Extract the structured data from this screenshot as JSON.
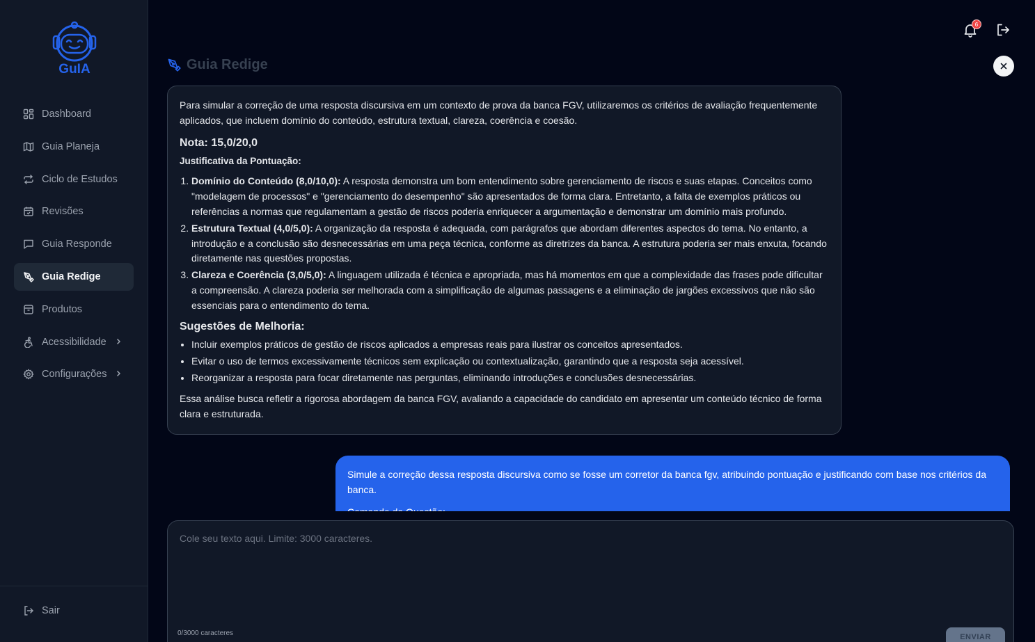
{
  "app": {
    "logo_text": "GuIA"
  },
  "sidebar": {
    "items": [
      {
        "label": "Dashboard",
        "icon": "dashboard-icon"
      },
      {
        "label": "Guia Planeja",
        "icon": "map-icon"
      },
      {
        "label": "Ciclo de Estudos",
        "icon": "repeat-icon"
      },
      {
        "label": "Revisões",
        "icon": "calendar-icon"
      },
      {
        "label": "Guia Responde",
        "icon": "message-icon"
      },
      {
        "label": "Guia Redige",
        "icon": "pen-tool-icon",
        "active": true
      },
      {
        "label": "Produtos",
        "icon": "box-icon"
      },
      {
        "label": "Acessibilidade",
        "icon": "accessibility-icon",
        "has_submenu": true
      },
      {
        "label": "Configurações",
        "icon": "gear-icon",
        "has_submenu": true
      }
    ],
    "logout_label": "Sair"
  },
  "header": {
    "notification_count": "6"
  },
  "page": {
    "title": "Guia Redige"
  },
  "bot_message": {
    "intro": "Para simular a correção de uma resposta discursiva em um contexto de prova da banca FGV, utilizaremos os critérios de avaliação frequentemente aplicados, que incluem domínio do conteúdo, estrutura textual, clareza, coerência e coesão.",
    "nota": "Nota: 15,0/20,0",
    "justificativa_title": "Justificativa da Pontuação:",
    "criteria": [
      {
        "title": "Domínio do Conteúdo (8,0/10,0):",
        "text": " A resposta demonstra um bom entendimento sobre gerenciamento de riscos e suas etapas. Conceitos como \"modelagem de processos\" e \"gerenciamento do desempenho\" são apresentados de forma clara. Entretanto, a falta de exemplos práticos ou referências a normas que regulamentam a gestão de riscos poderia enriquecer a argumentação e demonstrar um domínio mais profundo."
      },
      {
        "title": "Estrutura Textual (4,0/5,0):",
        "text": " A organização da resposta é adequada, com parágrafos que abordam diferentes aspectos do tema. No entanto, a introdução e a conclusão são desnecessárias em uma peça técnica, conforme as diretrizes da banca. A estrutura poderia ser mais enxuta, focando diretamente nas questões propostas."
      },
      {
        "title": "Clareza e Coerência (3,0/5,0):",
        "text": " A linguagem utilizada é técnica e apropriada, mas há momentos em que a complexidade das frases pode dificultar a compreensão. A clareza poderia ser melhorada com a simplificação de algumas passagens e a eliminação de jargões excessivos que não são essenciais para o entendimento do tema."
      }
    ],
    "suggestions_title": "Sugestões de Melhoria:",
    "suggestions": [
      "Incluir exemplos práticos de gestão de riscos aplicados a empresas reais para ilustrar os conceitos apresentados.",
      "Evitar o uso de termos excessivamente técnicos sem explicação ou contextualização, garantindo que a resposta seja acessível.",
      "Reorganizar a resposta para focar diretamente nas perguntas, eliminando introduções e conclusões desnecessárias."
    ],
    "closing": "Essa análise busca refletir a rigorosa abordagem da banca FGV, avaliando a capacidade do candidato em apresentar um conteúdo técnico de forma clara e estruturada."
  },
  "user_message": {
    "text": "Simule a correção dessa resposta discursiva como se fosse um corretor da banca fgv, atribuindo pontuação e justificando com base nos critérios da banca.",
    "sub": "Comando da Questão:"
  },
  "input": {
    "placeholder": "Cole seu texto aqui. Limite: 3000 caracteres.",
    "counter": "0/3000 caracteres",
    "send_label": "ENVIAR"
  },
  "colors": {
    "accent": "#2563eb",
    "background": "#020617",
    "sidebar": "#111827",
    "badge": "#ef4444"
  }
}
